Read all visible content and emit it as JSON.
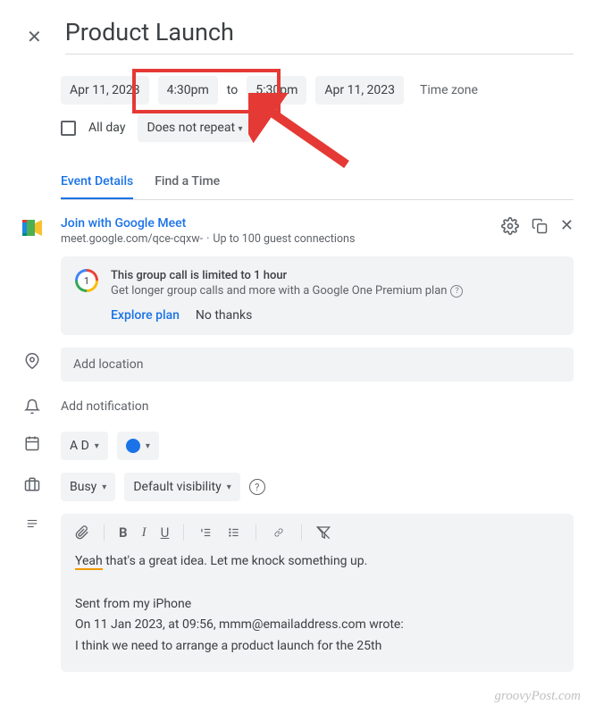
{
  "header": {
    "title": "Product Launch"
  },
  "datetime": {
    "startDate": "Apr 11, 2023",
    "startTime": "4:30pm",
    "to": "to",
    "endTime": "5:30pm",
    "endDate": "Apr 11, 2023",
    "timezone": "Time zone",
    "allDay": "All day",
    "repeat": "Does not repeat"
  },
  "tabs": {
    "details": "Event Details",
    "findTime": "Find a Time"
  },
  "meet": {
    "join": "Join with Google Meet",
    "url": "meet.google.com/qce-cqxw-",
    "guests": "Up to 100 guest connections"
  },
  "infoCard": {
    "badge": "1",
    "title": "This group call is limited to 1 hour",
    "sub": "Get longer group calls and more with a Google One Premium plan",
    "explore": "Explore plan",
    "noThanks": "No thanks"
  },
  "location": {
    "placeholder": "Add location"
  },
  "notification": {
    "label": "Add notification"
  },
  "calendar": {
    "owner": "A D"
  },
  "availability": {
    "busy": "Busy",
    "visibility": "Default visibility"
  },
  "description": {
    "line1a": "Yeah",
    "line1b": " that's a great idea. Let me knock something up.",
    "sent": "Sent from my iPhone",
    "quoteHeader": "On 11 Jan 2023, at 09:56, mmm@emailaddress.com wrote:",
    "quoteBody": "I think we need to arrange a product launch for the 25th"
  },
  "watermark": "groovyPost.com"
}
